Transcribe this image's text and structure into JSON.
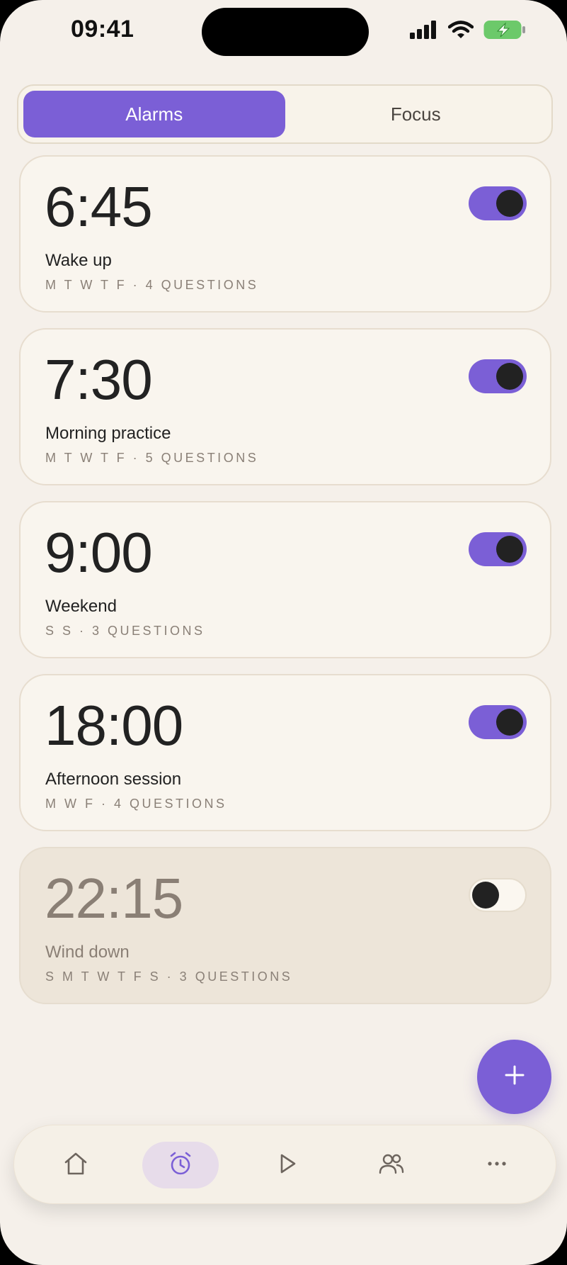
{
  "status_bar": {
    "time": "09:41",
    "icons": [
      "signal-icon",
      "wifi-icon",
      "battery-charging-icon"
    ]
  },
  "tabs": [
    {
      "label": "Alarms",
      "active": true
    },
    {
      "label": "Focus",
      "active": false
    }
  ],
  "alarms": [
    {
      "time": "6:45",
      "label": "Wake up",
      "meta": "M T W T F · 4 QUESTIONS",
      "enabled": true
    },
    {
      "time": "7:30",
      "label": "Morning practice",
      "meta": "M T W T F · 5 QUESTIONS",
      "enabled": true
    },
    {
      "time": "9:00",
      "label": "Weekend",
      "meta": "S S · 3 QUESTIONS",
      "enabled": true
    },
    {
      "time": "18:00",
      "label": "Afternoon session",
      "meta": "M W F · 4 QUESTIONS",
      "enabled": true
    },
    {
      "time": "22:15",
      "label": "Wind down",
      "meta": "S M T W T F S · 3 QUESTIONS",
      "enabled": false
    }
  ],
  "fab": {
    "icon": "plus-icon"
  },
  "bottom_nav": {
    "items": [
      {
        "icon": "home-icon",
        "active": false
      },
      {
        "icon": "alarm-clock-icon",
        "active": true
      },
      {
        "icon": "play-icon",
        "active": false
      },
      {
        "icon": "people-icon",
        "active": false
      },
      {
        "icon": "more-icon",
        "active": false
      }
    ]
  },
  "colors": {
    "accent": "#7b5fd6",
    "background": "#f5f0ea",
    "card": "#f9f5ee",
    "card_disabled": "#ede5d9"
  }
}
